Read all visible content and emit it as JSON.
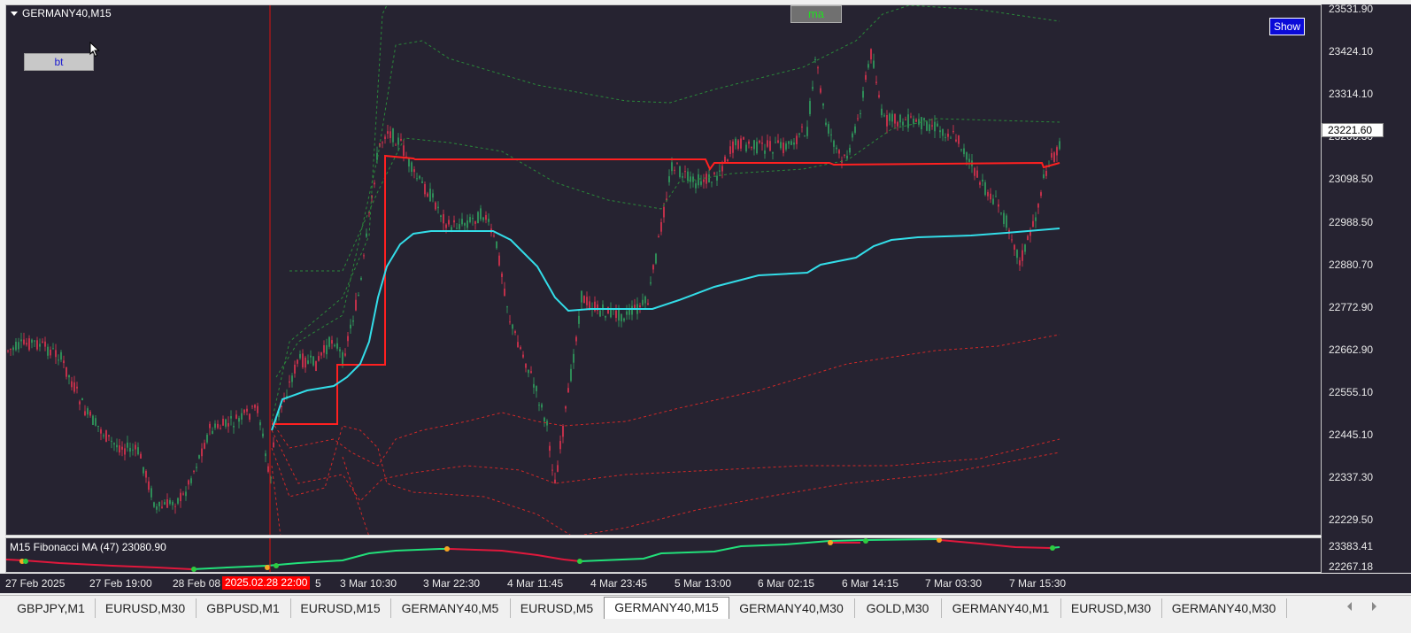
{
  "chart": {
    "symbol_title": "GERMANY40,M15",
    "buttons": {
      "bt": "bt",
      "ma": "ma",
      "show": "Show"
    },
    "current_price": "23221.60",
    "price_labels": [
      "23531.90",
      "23424.10",
      "23314.10",
      "23206.30",
      "23098.50",
      "22988.50",
      "22880.70",
      "22772.90",
      "22662.90",
      "22555.10",
      "22445.10",
      "22337.30",
      "22229.50"
    ],
    "time_labels": [
      "27 Feb 2025",
      "27 Feb 19:00",
      "28 Feb 08",
      "3 Mar 10:30",
      "3 Mar 22:30",
      "4 Mar 11:45",
      "4 Mar 23:45",
      "5 Mar 13:00",
      "6 Mar 02:15",
      "6 Mar 14:15",
      "7 Mar 03:30",
      "7 Mar 15:30"
    ],
    "crosshair_time": "2025.02.28 22:00",
    "crosshair_time_suffix": "5",
    "colors": {
      "background": "#262331",
      "bull": "#2e8b57",
      "bear": "#c0304a",
      "ma": "#33dde8",
      "step": "#ff2020",
      "upper_band": "#2a8a3a",
      "lower_band": "#d02828"
    }
  },
  "indicator": {
    "label": "M15 Fibonacci MA (47) 23080.90",
    "scale_labels": [
      "23383.41",
      "22267.18"
    ]
  },
  "tabs": [
    {
      "label": "GBPJPY,M1",
      "active": false
    },
    {
      "label": "EURUSD,M30",
      "active": false
    },
    {
      "label": "GBPUSD,M1",
      "active": false
    },
    {
      "label": "EURUSD,M15",
      "active": false
    },
    {
      "label": "GERMANY40,M5",
      "active": false
    },
    {
      "label": "EURUSD,M5",
      "active": false
    },
    {
      "label": "GERMANY40,M15",
      "active": true
    },
    {
      "label": "GERMANY40,M30",
      "active": false
    },
    {
      "label": "GOLD,M30",
      "active": false
    },
    {
      "label": "GERMANY40,M1",
      "active": false
    },
    {
      "label": "EURUSD,M30",
      "active": false
    },
    {
      "label": "GERMANY40,M30",
      "active": false
    }
  ]
}
